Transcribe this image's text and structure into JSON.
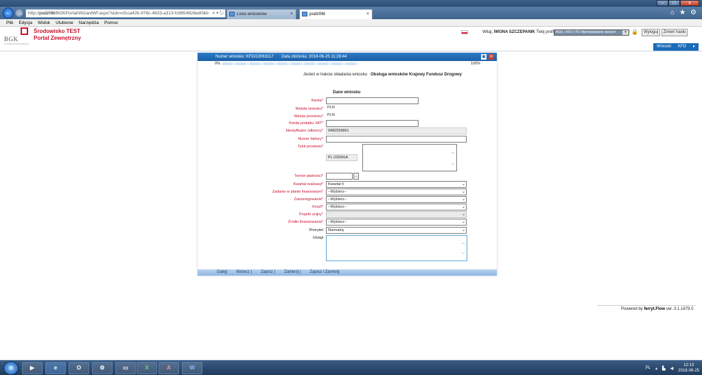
{
  "browser": {
    "url_prefix": "http://",
    "url_host": "psdz06t",
    "url_path": "/BGKPortal/WizardWf.aspx?sidx=cfcca42b-976c-4833-a313-fc9854828ed0&b",
    "addr_icons": "⌕ ▾ ↻",
    "tabs": [
      {
        "label": "Lista wniosków",
        "close": "×"
      },
      {
        "label": "psdz06t",
        "close": "×"
      }
    ],
    "win_buttons": {
      "minimize": "–",
      "maximize": "□",
      "close": "x"
    }
  },
  "menu": [
    "Plik",
    "Edycja",
    "Widok",
    "Ulubione",
    "Narzędzia",
    "Pomoc"
  ],
  "header": {
    "logo": "BGK",
    "title_line1": "Środowisko TEST",
    "title_line2": "Portal Zewnętrzny",
    "welcome": "Witaj,",
    "user": "IWONA SZCZEPANIK",
    "profile_label": "Twój profil:",
    "profile_value": "BGK / KFD / PZ Wprowadzanie danych",
    "logout": "Wyloguj",
    "change_password": "Zmień hasło"
  },
  "right_tabs": [
    "Wnioski",
    "KFD",
    "▸"
  ],
  "panel": {
    "number_label": "Numer wniosku:",
    "number_value": "KFD/22063117",
    "date_label": "Data złożenia:",
    "date_value": "2018-06-25 11:28:44",
    "progress_start": "0%",
    "progress_end": "100%",
    "progress_fraction": 0.55,
    "intro": "Jesteś w trakcie składania wniosku",
    "intro_bold": "Obsługa wniosków Krajowy Fundusz Drogowy",
    "section": "Dane wniosku"
  },
  "form": {
    "kwota": {
      "label": "Kwota*",
      "value": ""
    },
    "waluta_wniosku": {
      "label": "Waluta wniosku*",
      "value": "PLN"
    },
    "waluta_przelewu": {
      "label": "Waluta przelewu*",
      "value": "PLN"
    },
    "kwota_vat": {
      "label": "Kwota podatku VAT*",
      "value": ""
    },
    "identyfikator": {
      "label": "Identyfikator odbiorcy*",
      "value": "9482599861"
    },
    "numer_faktury": {
      "label": "Numer faktury*",
      "value": ""
    },
    "tytul_przelewu": {
      "label": "Tytuł przelewu*",
      "prefix": "PL ODDKIA"
    },
    "termin_platnosci": {
      "label": "Termin płatności*",
      "value": ""
    },
    "kwartal": {
      "label": "Kwartał realizacji*",
      "value": "Kwartał II"
    },
    "zadanie": {
      "label": "Zadanie w planie finansowym*",
      "value": "--Wybierz--"
    },
    "zaszeregowanie": {
      "label": "Zaszeregowanie*",
      "value": "--Wybierz--"
    },
    "koszt": {
      "label": "Koszt*",
      "value": "--Wybierz--"
    },
    "projekt_unijny": {
      "label": "Projekt unijny*",
      "value": ""
    },
    "zrodlo": {
      "label": "Źródło finansowania*",
      "value": "--Wybierz--"
    },
    "priorytet": {
      "label": "Priorytet",
      "value": "Normalny"
    },
    "uwagi": {
      "label": "Uwagi"
    }
  },
  "footer_buttons": [
    "Dalej|",
    "Wstecz |",
    "Zapisz |",
    "Zamknij |",
    "Zapisz i Zamknij"
  ],
  "powered": {
    "prefix": "Powered by",
    "brand": "ferryt.Flow",
    "version": "ver. 3.1.1879.0"
  },
  "taskbar": {
    "apps": [
      "▶",
      "e",
      "O",
      "⚙",
      "▭",
      "X",
      "A",
      "W"
    ],
    "lang": "PL",
    "time": "12:13",
    "date": "2018-06-25"
  },
  "colors": {
    "accent": "#1a5fa6",
    "required_label": "#c8102e"
  }
}
